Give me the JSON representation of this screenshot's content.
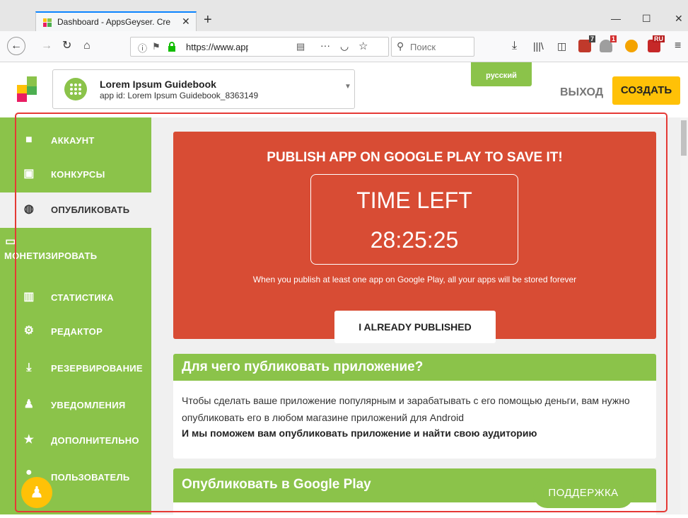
{
  "browser": {
    "tab_title": "Dashboard - AppsGeyser. Creat",
    "tab_close": "✕",
    "new_tab": "+",
    "url": "https://www.appsg",
    "search_placeholder": "Поиск",
    "extension_badges": [
      "7",
      "1",
      "RU"
    ],
    "window_controls": [
      "—",
      "☐",
      "✕"
    ]
  },
  "header": {
    "app_name": "Lorem Ipsum Guidebook",
    "app_id": "app id: Lorem Ipsum Guidebook_8363149",
    "language_label": "русский",
    "exit_label": "ВЫХОД",
    "create_label": "СОЗДАТЬ"
  },
  "sidebar": {
    "items": [
      {
        "label": "АККАУНТ",
        "icon": "briefcase-icon"
      },
      {
        "label": "КОНКУРСЫ",
        "icon": "gift-icon"
      },
      {
        "label": "ОПУБЛИКОВАТЬ",
        "icon": "globe-icon"
      },
      {
        "label": "МОНЕТИЗИРОВАТЬ",
        "icon": "money-icon"
      },
      {
        "label": "СТАТИСТИКА",
        "icon": "bar-chart-icon"
      },
      {
        "label": "РЕДАКТОР",
        "icon": "gears-icon"
      },
      {
        "label": "РЕЗЕРВИРОВАНИЕ",
        "icon": "download-icon"
      },
      {
        "label": "УВЕДОМЛЕНИЯ",
        "icon": "bell-icon"
      },
      {
        "label": "ДОПОЛНИТЕЛЬНО",
        "icon": "star-icon"
      },
      {
        "label": "ПОЛЬЗОВАТЕЛЬ",
        "icon": "user-icon"
      }
    ],
    "active_index": 2
  },
  "publish": {
    "title": "PUBLISH APP ON GOOGLE PLAY TO SAVE IT!",
    "timer_label": "TIME LEFT",
    "timer_value": "28:25:25",
    "note": "When you publish at least one app on Google Play, all your apps will be stored forever",
    "button_label": "I ALREADY PUBLISHED"
  },
  "why": {
    "title": "Для чего публиковать приложение?",
    "paragraph": "Чтобы сделать ваше приложение популярным и зарабатывать с его помощью деньги, вам нужно опубликовать его в любом магазине приложений для Android",
    "bold_line": "И мы поможем вам опубликовать приложение и найти свою аудиторию"
  },
  "gplay": {
    "title": "Опубликовать в Google Play"
  },
  "support_label": "ПОДДЕРЖКА",
  "colors": {
    "green": "#8bc34a",
    "red": "#d84c34",
    "yellow": "#ffc107",
    "frame": "#e53935"
  }
}
